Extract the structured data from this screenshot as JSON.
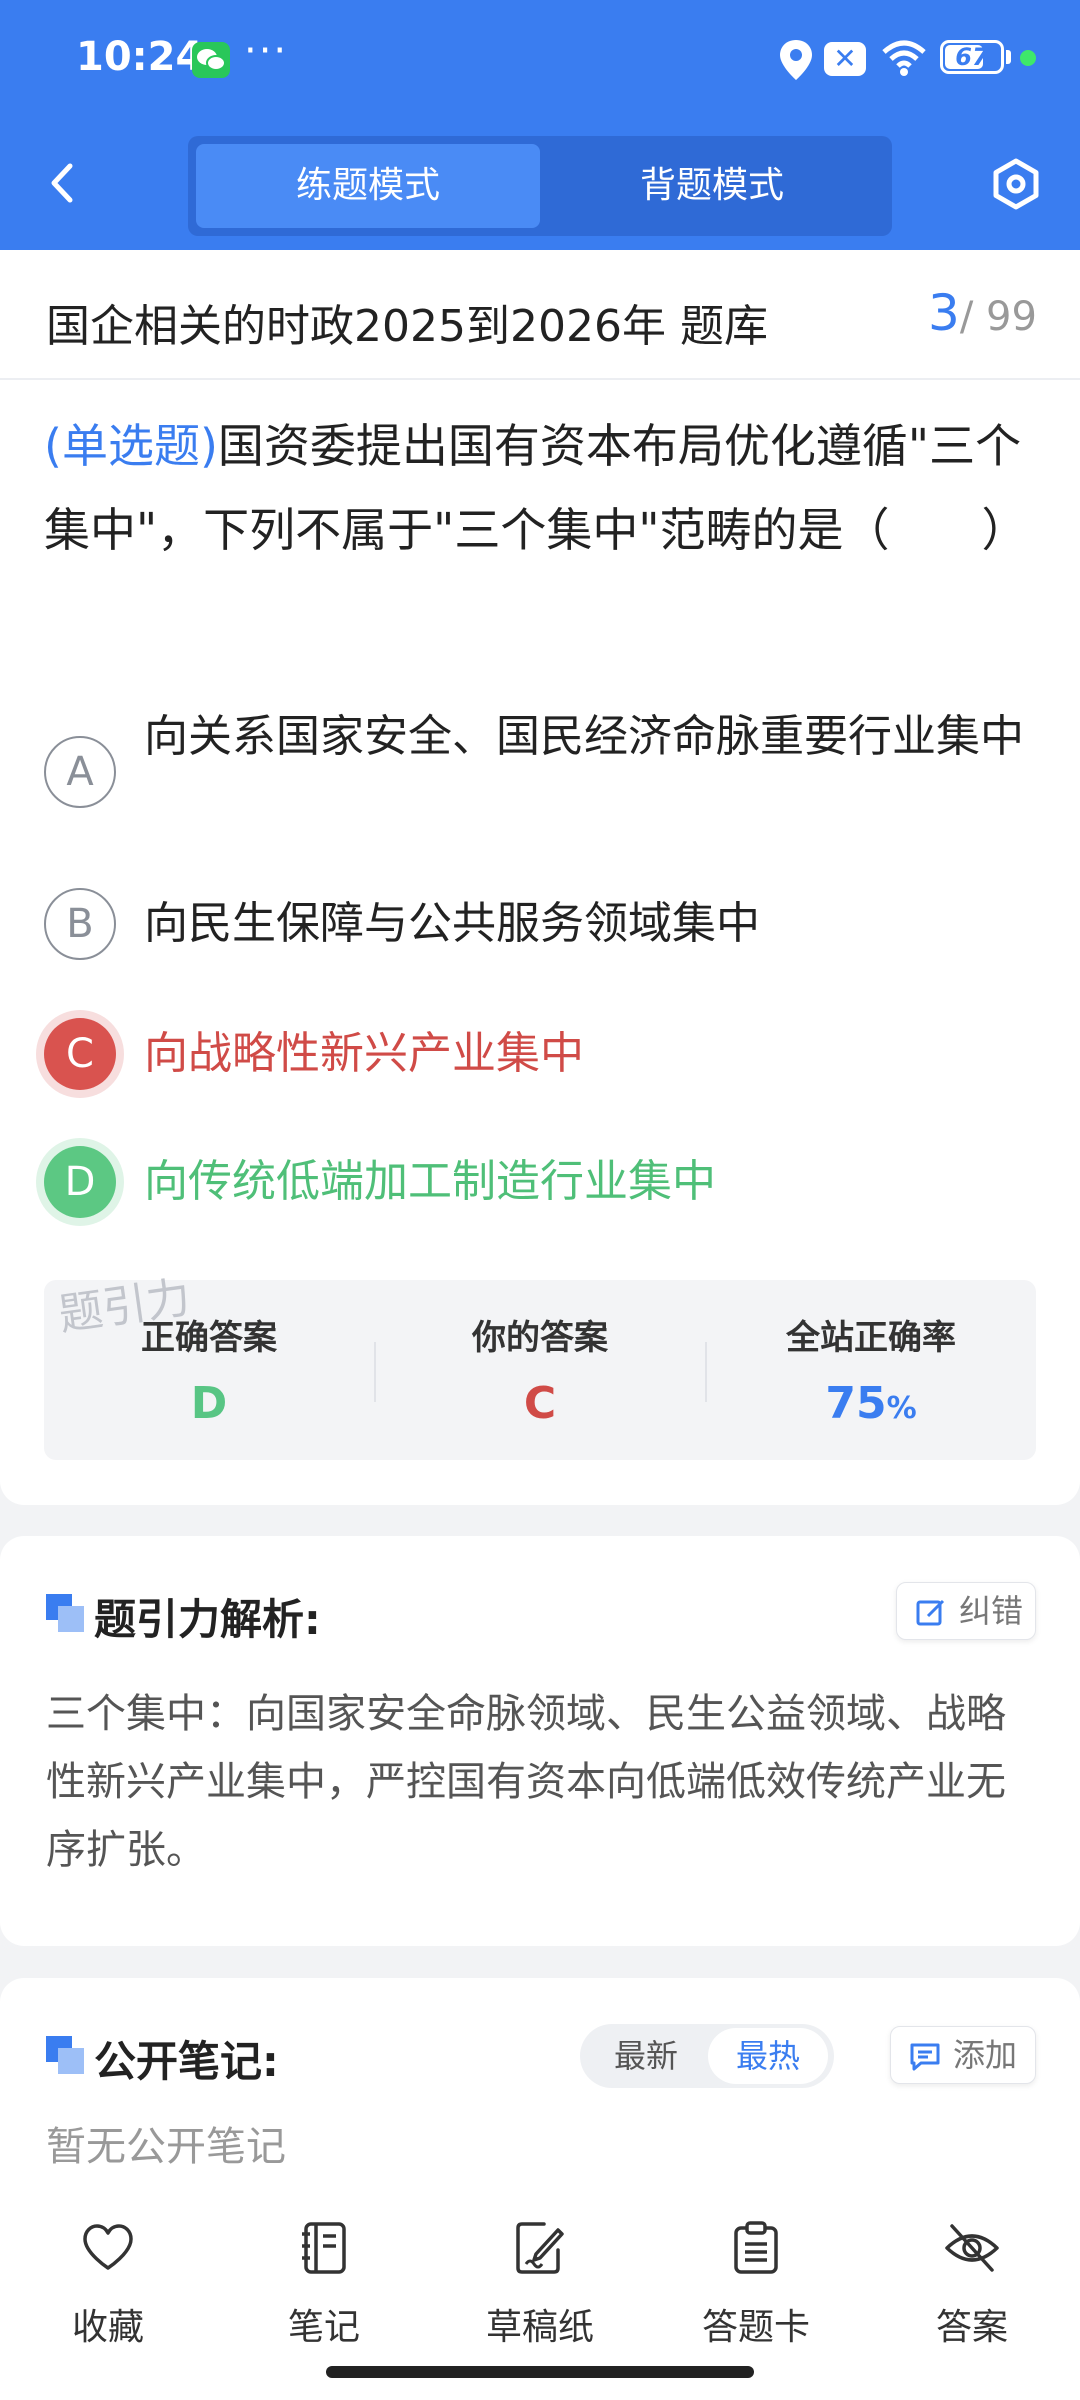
{
  "status_bar": {
    "time": "10:24",
    "more": "···",
    "battery": "67"
  },
  "header": {
    "tabs": [
      {
        "label": "练题模式"
      },
      {
        "label": "背题模式"
      }
    ]
  },
  "bank": {
    "title": "国企相关的时政2025到2026年 题库",
    "current": "3",
    "total": "/ 99"
  },
  "question": {
    "type_label": "(单选题)",
    "text": "国资委提出国有资本布局优化遵循\"三个集中\"，下列不属于\"三个集中\"范畴的是（　　）"
  },
  "options": [
    {
      "letter": "A",
      "text": "向关系国家安全、国民经济命脉重要行业集中",
      "state": "normal"
    },
    {
      "letter": "B",
      "text": "向民生保障与公共服务领域集中",
      "state": "normal"
    },
    {
      "letter": "C",
      "text": "向战略性新兴产业集中",
      "state": "wrong"
    },
    {
      "letter": "D",
      "text": "向传统低端加工制造行业集中",
      "state": "correct"
    }
  ],
  "watermark": "题引力",
  "answers": {
    "correct_label": "正确答案",
    "correct_value": "D",
    "yours_label": "你的答案",
    "yours_value": "C",
    "rate_label": "全站正确率",
    "rate_value": "75",
    "rate_unit": "%"
  },
  "analysis": {
    "title": "题引力解析:",
    "report_label": "纠错",
    "text": "三个集中：向国家安全命脉领域、民生公益领域、战略性新兴产业集中，严控国有资本向低端低效传统产业无序扩张。"
  },
  "notes": {
    "title": "公开笔记:",
    "sort_latest": "最新",
    "sort_hot": "最热",
    "add_label": "添加",
    "empty_text": "暂无公开笔记"
  },
  "bottom_nav": [
    {
      "label": "收藏",
      "icon": "heart-icon"
    },
    {
      "label": "笔记",
      "icon": "notebook-icon"
    },
    {
      "label": "草稿纸",
      "icon": "draft-paper-icon"
    },
    {
      "label": "答题卡",
      "icon": "answer-card-icon"
    },
    {
      "label": "答案",
      "icon": "eye-off-icon"
    }
  ],
  "colors": {
    "primary": "#3a7df0",
    "correct": "#58c584",
    "wrong": "#d04b47"
  }
}
